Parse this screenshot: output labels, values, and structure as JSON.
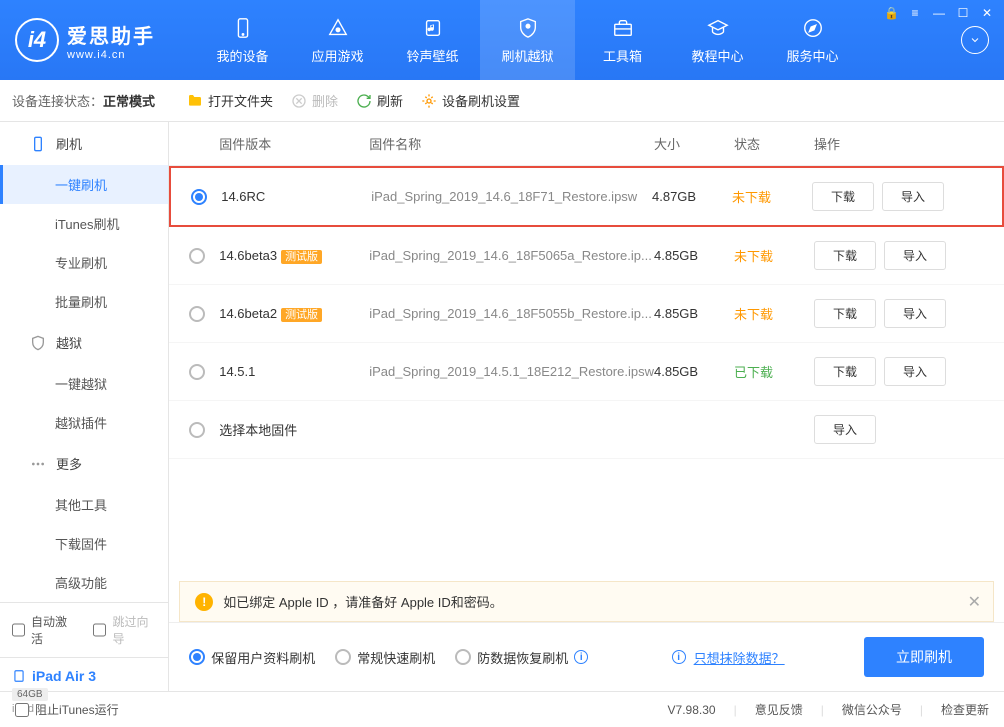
{
  "app": {
    "title": "爱思助手",
    "url": "www.i4.cn"
  },
  "nav": {
    "items": [
      {
        "label": "我的设备"
      },
      {
        "label": "应用游戏"
      },
      {
        "label": "铃声壁纸"
      },
      {
        "label": "刷机越狱"
      },
      {
        "label": "工具箱"
      },
      {
        "label": "教程中心"
      },
      {
        "label": "服务中心"
      }
    ]
  },
  "toolbar": {
    "status_label": "设备连接状态：",
    "status_value": "正常模式",
    "open_folder": "打开文件夹",
    "delete": "删除",
    "refresh": "刷新",
    "settings": "设备刷机设置"
  },
  "sidebar": {
    "sections": [
      {
        "label": "刷机",
        "items": [
          "一键刷机",
          "iTunes刷机",
          "专业刷机",
          "批量刷机"
        ]
      },
      {
        "label": "越狱",
        "items": [
          "一键越狱",
          "越狱插件"
        ]
      },
      {
        "label": "更多",
        "items": [
          "其他工具",
          "下载固件",
          "高级功能"
        ]
      }
    ],
    "auto_activate": "自动激活",
    "skip_guide": "跳过向导"
  },
  "device": {
    "name": "iPad Air 3",
    "storage": "64GB",
    "type": "iPad"
  },
  "table": {
    "headers": {
      "version": "固件版本",
      "name": "固件名称",
      "size": "大小",
      "status": "状态",
      "action": "操作"
    },
    "rows": [
      {
        "version": "14.6RC",
        "beta": "",
        "name": "iPad_Spring_2019_14.6_18F71_Restore.ipsw",
        "size": "4.87GB",
        "status": "未下载",
        "status_color": "orange",
        "selected": true,
        "highlighted": true
      },
      {
        "version": "14.6beta3",
        "beta": "测试版",
        "name": "iPad_Spring_2019_14.6_18F5065a_Restore.ip...",
        "size": "4.85GB",
        "status": "未下载",
        "status_color": "orange"
      },
      {
        "version": "14.6beta2",
        "beta": "测试版",
        "name": "iPad_Spring_2019_14.6_18F5055b_Restore.ip...",
        "size": "4.85GB",
        "status": "未下载",
        "status_color": "orange"
      },
      {
        "version": "14.5.1",
        "beta": "",
        "name": "iPad_Spring_2019_14.5.1_18E212_Restore.ipsw",
        "size": "4.85GB",
        "status": "已下载",
        "status_color": "green"
      },
      {
        "version": "选择本地固件",
        "beta": "",
        "name": "",
        "size": "",
        "status": "",
        "local": true
      }
    ],
    "download_btn": "下载",
    "import_btn": "导入"
  },
  "warning": {
    "text": "如已绑定 Apple ID ，请准备好 Apple ID和密码。"
  },
  "options": {
    "keep_data": "保留用户资料刷机",
    "normal_fast": "常规快速刷机",
    "anti_data_recovery": "防数据恢复刷机",
    "erase_link": "只想抹除数据？",
    "primary_btn": "立即刷机"
  },
  "statusbar": {
    "block_itunes": "阻止iTunes运行",
    "version": "V7.98.30",
    "feedback": "意见反馈",
    "wechat": "微信公众号",
    "check_update": "检查更新"
  }
}
